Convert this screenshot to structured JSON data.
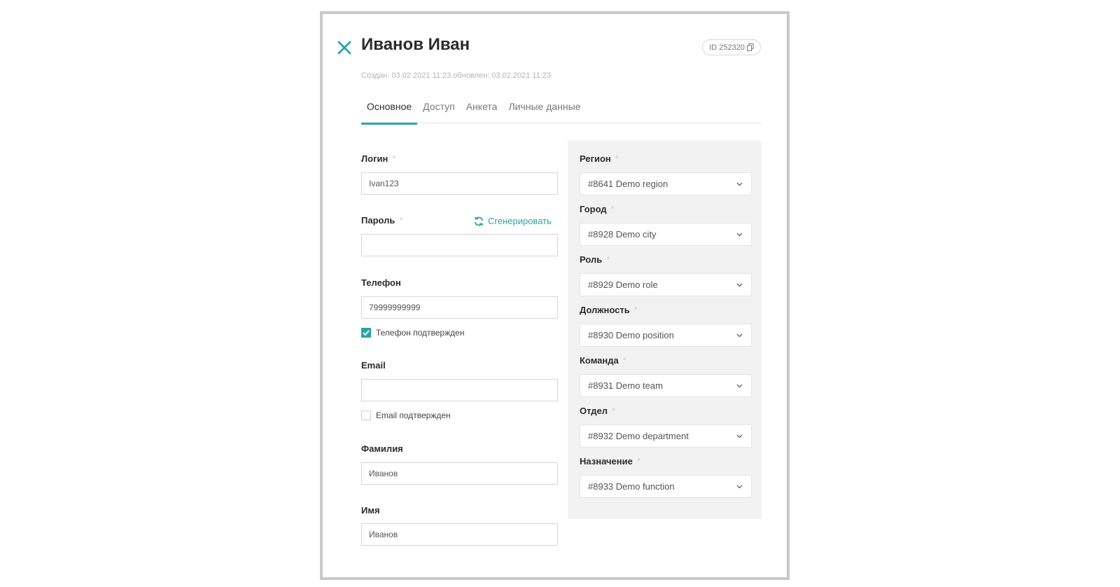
{
  "header": {
    "title": "Иванов Иван",
    "id_badge": "ID 252320",
    "meta": "Создан: 03.02.2021 11:23 обновлен: 03.02.2021 11:23"
  },
  "tabs": [
    {
      "label": "Основное",
      "active": true
    },
    {
      "label": "Доступ",
      "active": false
    },
    {
      "label": "Анкета",
      "active": false
    },
    {
      "label": "Личные данные",
      "active": false
    }
  ],
  "form": {
    "login": {
      "label": "Логин",
      "required_mark": "*",
      "value": "Ivan123"
    },
    "password": {
      "label": "Пароль",
      "required_mark": "*",
      "value": "",
      "generate_label": "Сгенерировать"
    },
    "phone": {
      "label": "Телефон",
      "value": "79999999999",
      "confirmed_label": "Телефон подтвержден",
      "confirmed": true
    },
    "email": {
      "label": "Email",
      "value": "",
      "confirmed_label": "Email подтвержден",
      "confirmed": false
    },
    "surname": {
      "label": "Фамилия",
      "value": "Иванов"
    },
    "name": {
      "label": "Имя",
      "value": "Иванов"
    }
  },
  "selects": [
    {
      "label": "Регион",
      "required_mark": "*",
      "value": "#8641 Demo region"
    },
    {
      "label": "Город",
      "required_mark": "*",
      "value": "#8928 Demo city"
    },
    {
      "label": "Роль",
      "required_mark": "*",
      "value": "#8929 Demo role"
    },
    {
      "label": "Должность",
      "required_mark": "*",
      "value": "#8930 Demo position"
    },
    {
      "label": "Команда",
      "required_mark": "*",
      "value": "#8931 Demo team"
    },
    {
      "label": "Отдел",
      "required_mark": "*",
      "value": "#8932 Demo department"
    },
    {
      "label": "Назначение",
      "required_mark": "*",
      "value": "#8933 Demo function"
    }
  ],
  "colors": {
    "accent": "#2aa3a6",
    "panel_bg": "#f2f2f2",
    "frame_border": "#c9c9c9"
  },
  "icons": {
    "close": "close-icon",
    "copy": "copy-icon",
    "refresh": "refresh-icon",
    "chevron": "chevron-down-icon",
    "check": "check-icon"
  }
}
